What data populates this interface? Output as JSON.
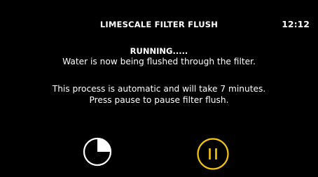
{
  "header": {
    "title": "LIMESCALE FILTER FLUSH",
    "time": "12:12"
  },
  "status": {
    "label": "RUNNING.....",
    "message": "Water is now being flushed through the filter."
  },
  "info": {
    "line1": "This process is automatic and will take 7 minutes.",
    "line2": "Press pause to pause filter flush."
  },
  "progress": {
    "icon": "timer-icon",
    "fraction_elapsed": 0.25
  },
  "controls": {
    "pause_icon": "pause-icon"
  },
  "colors": {
    "background": "#000000",
    "text": "#ffffff",
    "accent": "#f2c40f"
  }
}
